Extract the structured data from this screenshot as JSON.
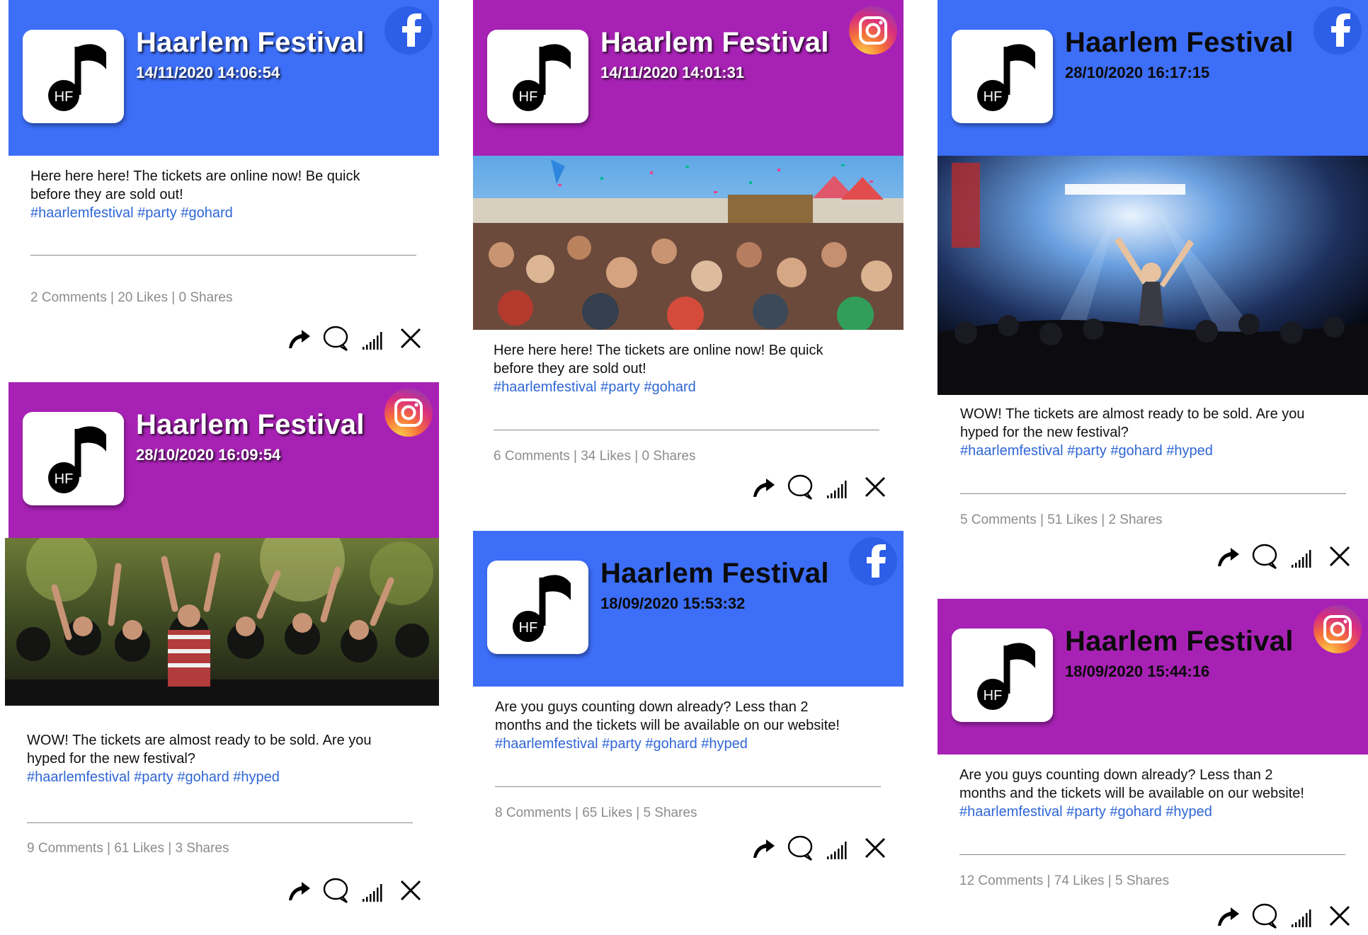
{
  "brand": {
    "name": "Haarlem Festival",
    "logo_text": "HF",
    "colors": {
      "facebook_blue": "#3d6ef8",
      "instagram_purple": "#a722b4",
      "hashtag_blue": "#2f66d6",
      "stats_gray": "#8c8c8c"
    }
  },
  "posts": [
    {
      "network": "facebook",
      "network_icon": "facebook-icon",
      "date": "14/11/2020 14:06:54",
      "caption_lines": [
        "Here here here! The tickets are online now! Be quick",
        "before they are sold out!"
      ],
      "hashtags": "#haarlemfestival #party #gohard",
      "stats": "2 Comments | 20 Likes | 0 Shares",
      "has_photo": false
    },
    {
      "network": "instagram",
      "network_icon": "instagram-icon",
      "date": "14/11/2020 14:01:31",
      "caption_lines": [
        "Here here here! The tickets are online now! Be quick",
        "before they are sold out!"
      ],
      "hashtags": "#haarlemfestival #party #gohard",
      "stats": "6 Comments | 34 Likes | 0 Shares",
      "has_photo": true
    },
    {
      "network": "facebook",
      "network_icon": "facebook-icon",
      "date": "28/10/2020 16:17:15",
      "caption_lines": [
        "WOW! The tickets are almost ready to be sold. Are you",
        "hyped for the new festival?"
      ],
      "hashtags": "#haarlemfestival #party #gohard #hyped",
      "stats": "5 Comments | 51 Likes | 2 Shares",
      "has_photo": true
    },
    {
      "network": "instagram",
      "network_icon": "instagram-icon",
      "date": "28/10/2020 16:09:54",
      "caption_lines": [
        "WOW! The tickets are almost ready to be sold. Are you",
        "hyped for the new festival?"
      ],
      "hashtags": "#haarlemfestival #party #gohard #hyped",
      "stats": "9 Comments | 61 Likes | 3 Shares",
      "has_photo": true
    },
    {
      "network": "facebook",
      "network_icon": "facebook-icon",
      "date": "18/09/2020 15:53:32",
      "caption_lines": [
        "Are you guys counting down already? Less than 2",
        "months and the tickets will be available on our website!"
      ],
      "hashtags": "#haarlemfestival #party #gohard #hyped",
      "stats": "8 Comments | 65 Likes | 5 Shares",
      "has_photo": false
    },
    {
      "network": "instagram",
      "network_icon": "instagram-icon",
      "date": "18/09/2020 15:44:16",
      "caption_lines": [
        "Are you guys counting down already? Less than 2",
        "months and the tickets will be available on our website!"
      ],
      "hashtags": "#haarlemfestival #party #gohard #hyped",
      "stats": "12 Comments | 74 Likes | 5 Shares",
      "has_photo": false
    }
  ],
  "action_icons": [
    "share-arrow-icon",
    "comment-bubble-icon",
    "signal-bars-icon",
    "close-icon"
  ]
}
